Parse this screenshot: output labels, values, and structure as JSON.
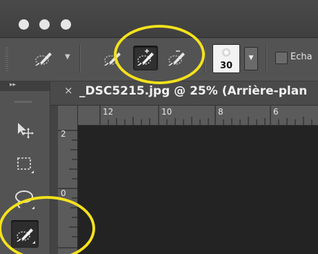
{
  "options_bar": {
    "brush_size": "30",
    "checkbox_label": "Echa"
  },
  "document": {
    "close_glyph": "×",
    "tab_title": "_DSC5215.jpg @ 25% (Arrière-plan"
  },
  "ruler": {
    "h_ticks": [
      "12",
      "10",
      "8",
      "6"
    ],
    "v_ticks": [
      "2",
      "0"
    ]
  },
  "toolbox": {
    "collapse_glyph": "▸▸",
    "tools": [
      "move-tool",
      "marquee-tool",
      "lasso-tool",
      "quick-selection-tool"
    ]
  },
  "icons": {
    "quick_selection": "quick-selection-icon",
    "add_selection": "add-to-selection-icon",
    "subtract_selection": "subtract-from-selection-icon"
  },
  "colors": {
    "highlight": "#f4e21c",
    "panel": "#535353",
    "canvas": "#232323"
  }
}
